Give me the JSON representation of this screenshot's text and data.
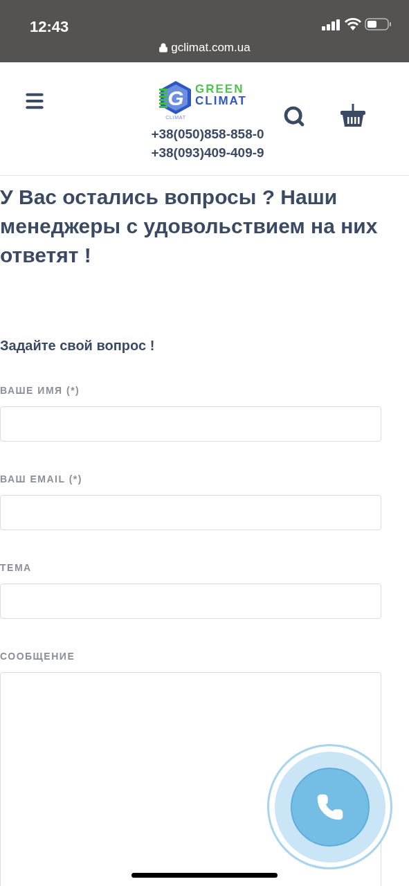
{
  "status_bar": {
    "time": "12:43",
    "url": "gclimat.com.ua"
  },
  "header": {
    "logo": {
      "line_1": "GREEN",
      "line_2": "CLIMAT",
      "caption": "CLIMAT",
      "letter": "G"
    },
    "phones": [
      "+38(050)858-858-0",
      "+38(093)409-409-9"
    ]
  },
  "title": "У Вас остались вопросы ? Наши менеджеры с удовольствием на них ответят !",
  "form": {
    "heading": "Задайте свой вопрос !",
    "fields": [
      {
        "label": "ВАШЕ ИМЯ (*)",
        "kind": "input"
      },
      {
        "label": "ВАШ EMAIL (*)",
        "kind": "input"
      },
      {
        "label": "ТЕМА",
        "kind": "input"
      },
      {
        "label": "СООБЩЕНИЕ",
        "kind": "textarea"
      }
    ]
  }
}
